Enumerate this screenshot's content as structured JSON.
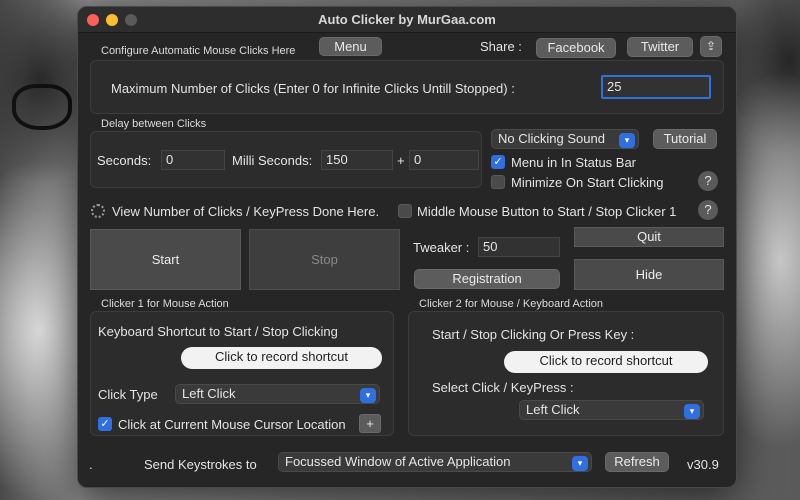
{
  "window": {
    "title": "Auto Clicker by MurGaa.com"
  },
  "header": {
    "configure_label": "Configure Automatic Mouse Clicks Here",
    "menu_label": "Menu",
    "share_label": "Share :",
    "facebook_label": "Facebook",
    "twitter_label": "Twitter"
  },
  "max_clicks": {
    "label": "Maximum Number of Clicks (Enter 0 for Infinite Clicks Untill Stopped) :",
    "value": "25"
  },
  "delay": {
    "group_label": "Delay between Clicks",
    "seconds_label": "Seconds:",
    "seconds_value": "0",
    "ms_label": "Milli Seconds:",
    "ms_value": "150",
    "plus_label": "+",
    "extra_value": "0"
  },
  "options": {
    "sound_select": "No Clicking Sound",
    "tutorial_label": "Tutorial",
    "menu_status_bar": {
      "label": "Menu in In Status Bar",
      "checked": true
    },
    "minimize_on_start": {
      "label": "Minimize On Start Clicking",
      "checked": false
    },
    "help_label": "?",
    "middle_mouse": {
      "label": "Middle Mouse Button to Start / Stop Clicker 1",
      "checked": false
    }
  },
  "status": {
    "view_label": "View Number of Clicks / KeyPress Done Here."
  },
  "controls": {
    "start_label": "Start",
    "stop_label": "Stop",
    "tweaker_label": "Tweaker :",
    "tweaker_value": "50",
    "registration_label": "Registration",
    "quit_label": "Quit",
    "hide_label": "Hide"
  },
  "clicker1": {
    "group_label": "Clicker 1 for Mouse Action",
    "shortcut_label": "Keyboard Shortcut to Start / Stop Clicking",
    "record_label": "Click to record shortcut",
    "click_type_label": "Click Type",
    "click_type_value": "Left Click",
    "cursor_location": {
      "label": "Click at Current Mouse Cursor Location",
      "checked": true
    },
    "add_label": "+"
  },
  "clicker2": {
    "group_label": "Clicker 2 for Mouse / Keyboard Action",
    "start_stop_label": "Start / Stop Clicking Or Press Key :",
    "record_label": "Click to record shortcut",
    "select_label": "Select Click / KeyPress :",
    "select_value": "Left Click"
  },
  "footer": {
    "dot": ".",
    "send_label": "Send Keystrokes to",
    "target_value": "Focussed Window of Active Application",
    "refresh_label": "Refresh",
    "version": "v30.9"
  },
  "colors": {
    "accent": "#2f6fe0",
    "window_bg": "#262626",
    "close": "#fe5f57",
    "minimize": "#febc2e"
  }
}
